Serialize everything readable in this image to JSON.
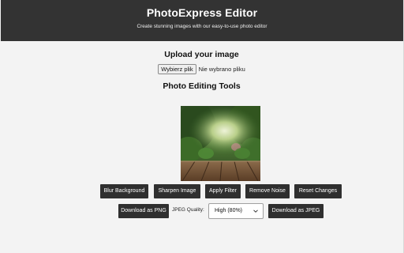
{
  "header": {
    "title": "PhotoExpress Editor",
    "subtitle": "Create stunning images with our easy-to-use photo editor"
  },
  "upload": {
    "title": "Upload your image",
    "file_button_label": "Wybierz plik",
    "file_status": "Nie wybrano pliku"
  },
  "tools": {
    "title": "Photo Editing Tools",
    "buttons": [
      "Blur Background",
      "Sharpen Image",
      "Apply Filter",
      "Remove Noise",
      "Reset Changes"
    ]
  },
  "export": {
    "download_png_label": "Download as PNG",
    "jpeg_quality_label": "JPEG Quality:",
    "jpeg_quality_selected": "High (80%)",
    "download_jpeg_label": "Download as JPEG"
  },
  "colors": {
    "header_bg": "#333333",
    "button_bg": "#2f2f2f",
    "page_bg": "#f3f3f3"
  },
  "icons": {
    "select_chevron": "chevron-down-icon"
  }
}
